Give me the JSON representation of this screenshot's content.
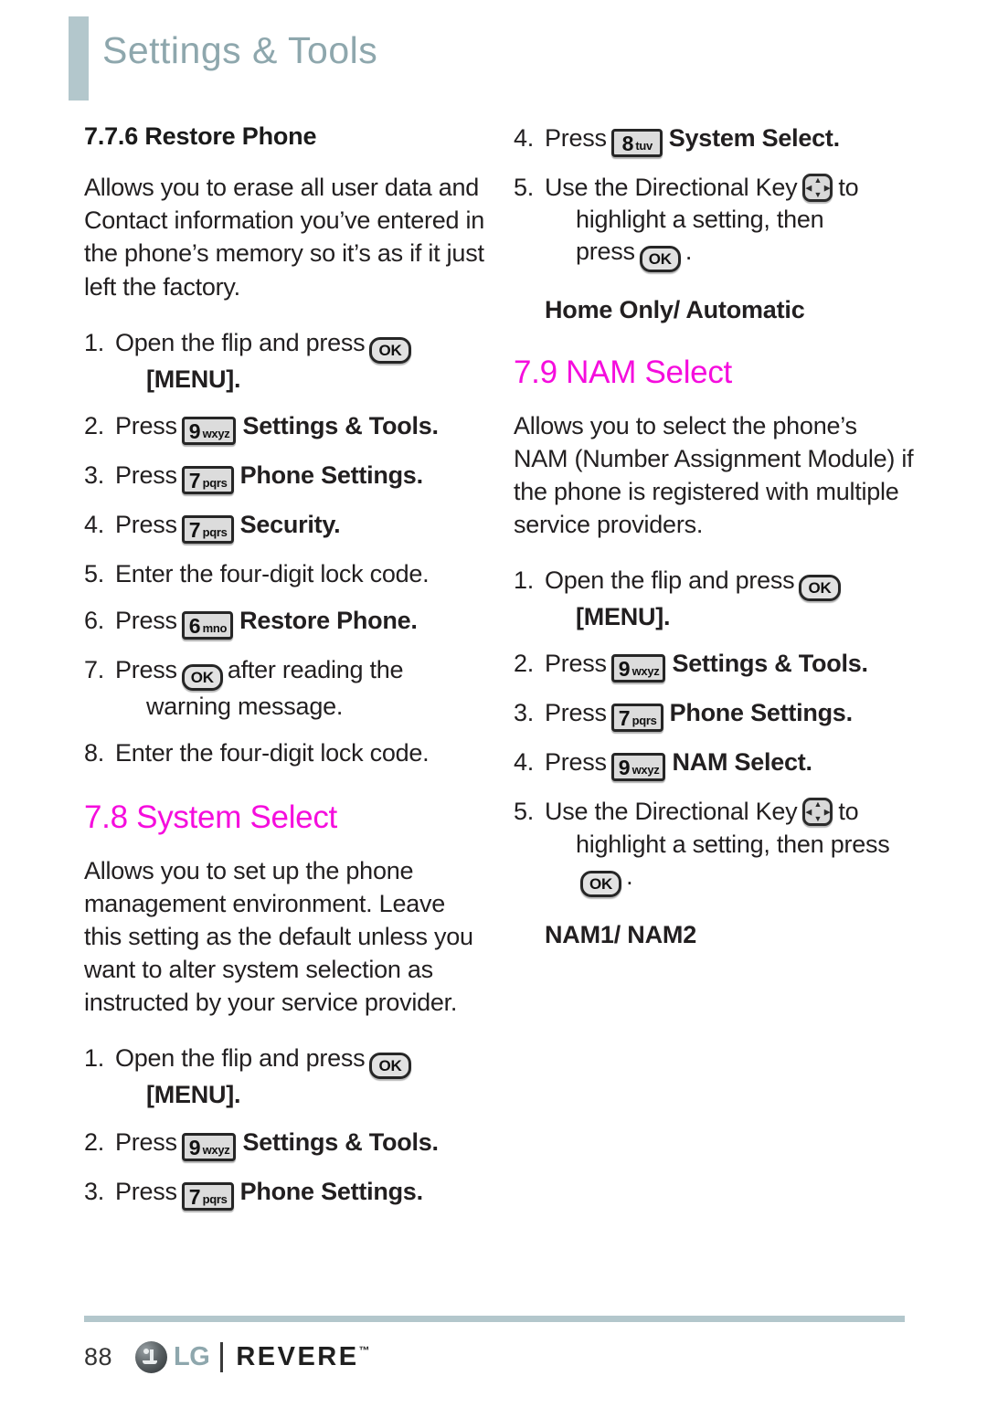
{
  "header": {
    "title": "Settings & Tools"
  },
  "left_column": {
    "subsection_title": "7.7.6 Restore Phone",
    "restore_description": "Allows you to erase all user data and Contact information you’ve entered in the phone’s memory so it’s as if it just left the factory.",
    "restore_steps": [
      {
        "num": "1.",
        "pre": "Open the flip and press",
        "key": "OK",
        "key_type": "ok",
        "post": "",
        "second_line": "[MENU]."
      },
      {
        "num": "2.",
        "pre": "Press",
        "key_digit": "9",
        "key_letters": "wxyz",
        "key_type": "keypad",
        "post": "Settings & Tools."
      },
      {
        "num": "3.",
        "pre": "Press",
        "key_digit": "7",
        "key_letters": "pqrs",
        "key_type": "keypad",
        "post": "Phone Settings."
      },
      {
        "num": "4.",
        "pre": "Press",
        "key_digit": "7",
        "key_letters": "pqrs",
        "key_type": "keypad",
        "post": "Security."
      },
      {
        "num": "5.",
        "pre": "Enter the four-digit lock code.",
        "key_type": "none",
        "post": ""
      },
      {
        "num": "6.",
        "pre": "Press",
        "key_digit": "6",
        "key_letters": "mno",
        "key_type": "keypad",
        "post": "Restore Phone."
      },
      {
        "num": "7.",
        "pre": "Press",
        "key": "OK",
        "key_type": "ok",
        "post": "after reading the",
        "second_line": "warning message."
      },
      {
        "num": "8.",
        "pre": "Enter the four-digit lock code.",
        "key_type": "none",
        "post": ""
      }
    ],
    "system_select_heading": "7.8 System Select",
    "system_select_description": "Allows you to set up the phone management environment. Leave this setting as the default unless you want to alter system selection as instructed by your service provider.",
    "system_select_steps": [
      {
        "num": "1.",
        "pre": "Open the flip and press",
        "key": "OK",
        "key_type": "ok",
        "post": "",
        "second_line": "[MENU]."
      },
      {
        "num": "2.",
        "pre": "Press",
        "key_digit": "9",
        "key_letters": "wxyz",
        "key_type": "keypad",
        "post": "Settings & Tools."
      },
      {
        "num": "3.",
        "pre": "Press",
        "key_digit": "7",
        "key_letters": "pqrs",
        "key_type": "keypad",
        "post": "Phone Settings."
      }
    ]
  },
  "right_column": {
    "system_select_steps_cont": [
      {
        "num": "4.",
        "pre": "Press",
        "key_digit": "8",
        "key_letters": "tuv",
        "key_type": "keypad",
        "post": "System Select."
      },
      {
        "num": "5.",
        "pre": "Use the Directional Key",
        "key_type": "directional",
        "post": "to",
        "line2_pre": "highlight a setting, then",
        "line3_pre": "press",
        "line3_key": "OK",
        "line3_post": "."
      }
    ],
    "system_select_options": "Home Only/ Automatic",
    "nam_heading": "7.9 NAM Select",
    "nam_description": "Allows you to select the phone’s NAM (Number Assignment Module) if the phone is registered with multiple service providers.",
    "nam_steps": [
      {
        "num": "1.",
        "pre": "Open the flip and press",
        "key": "OK",
        "key_type": "ok",
        "post": "",
        "second_line": "[MENU]."
      },
      {
        "num": "2.",
        "pre": "Press",
        "key_digit": "9",
        "key_letters": "wxyz",
        "key_type": "keypad",
        "post": "Settings & Tools."
      },
      {
        "num": "3.",
        "pre": "Press",
        "key_digit": "7",
        "key_letters": "pqrs",
        "key_type": "keypad",
        "post": "Phone Settings."
      },
      {
        "num": "4.",
        "pre": "Press",
        "key_digit": "9",
        "key_letters": "wxyz",
        "key_type": "keypad",
        "post": "NAM Select."
      },
      {
        "num": "5.",
        "pre": "Use the Directional Key",
        "key_type": "directional",
        "post": "to",
        "line2_pre": "highlight a setting, then press",
        "line2_key": "OK",
        "line2_post": "."
      }
    ],
    "nam_options": "NAM1/ NAM2"
  },
  "footer": {
    "page_number": "88",
    "brand": "LG",
    "model": "REVERE",
    "trademark": "™"
  },
  "colors": {
    "heading_pink": "#f50ddd",
    "header_gray_blue": "#8ea7ad",
    "rule_blue": "#b3c7cc"
  }
}
